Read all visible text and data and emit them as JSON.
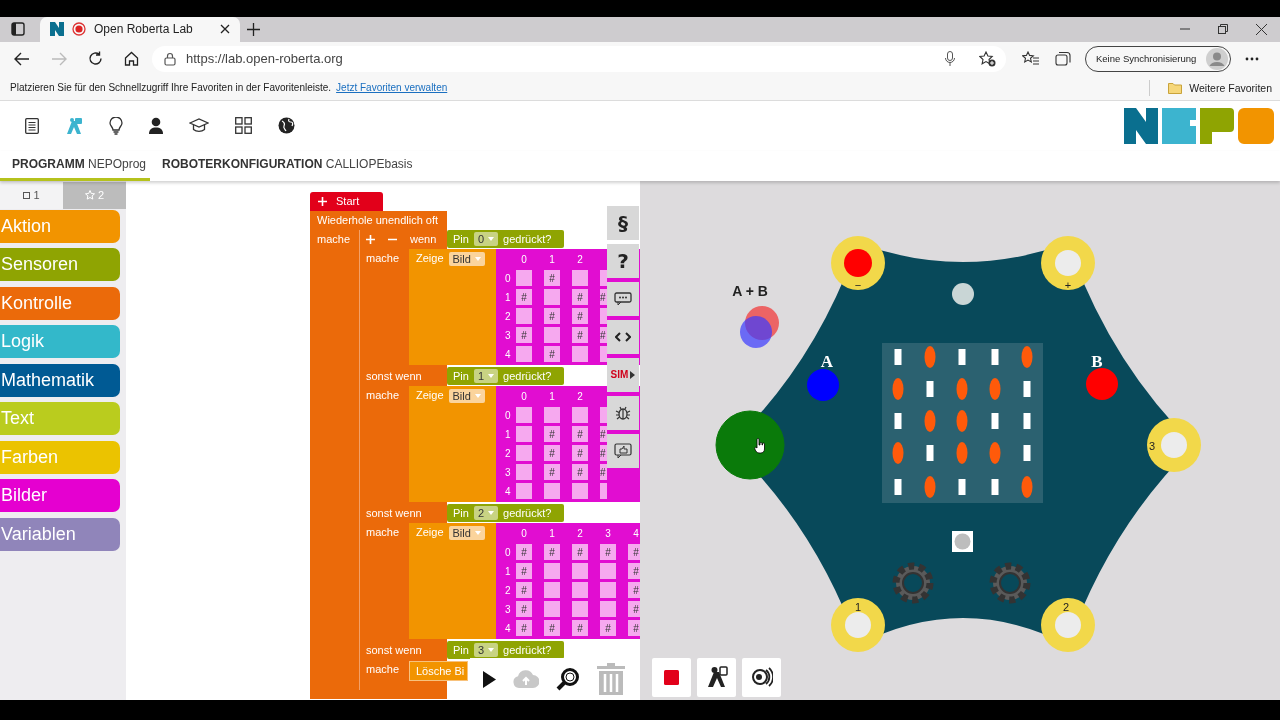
{
  "browser": {
    "tab_title": "Open Roberta Lab",
    "url": "https://lab.open-roberta.org",
    "profile": "Keine Synchronisierung",
    "favorites_hint": "Platzieren Sie für den Schnellzugriff Ihre Favoriten in der Favoritenleiste.",
    "favorites_link": "Jetzt Favoriten verwalten",
    "other_favorites": "Weitere Favoriten"
  },
  "app_tabs": [
    {
      "label": "**PROGRAMM** NEPOprog",
      "selected": true
    },
    {
      "label": "**ROBOTERKONFIGURATION** CALLIOPEbasis",
      "selected": false
    }
  ],
  "toolbox": {
    "levels": [
      {
        "label": "1",
        "selected": true
      },
      {
        "label": "2",
        "selected": false
      }
    ],
    "categories": [
      {
        "label": "Aktion",
        "color": "#f29400"
      },
      {
        "label": "Sensoren",
        "color": "#8fa402"
      },
      {
        "label": "Kontrolle",
        "color": "#eb6a0a"
      },
      {
        "label": "Logik",
        "color": "#33b8ca"
      },
      {
        "label": "Mathematik",
        "color": "#005a94"
      },
      {
        "label": "Text",
        "color": "#bacc1e"
      },
      {
        "label": "Farben",
        "color": "#ebc300"
      },
      {
        "label": "Bilder",
        "color": "#e500d0"
      },
      {
        "label": "Variablen",
        "color": "#9085ba"
      }
    ]
  },
  "program": {
    "start": "Start",
    "loop": {
      "label": "Wiederhole unendlich oft",
      "do_label": "mache",
      "branches": [
        {
          "label": "wenn",
          "mutator": true,
          "sensor": "Pin",
          "pin": "0",
          "condition": "gedrückt?",
          "do_label": "mache",
          "statement": {
            "kind": "image",
            "verb": "Zeige",
            "field": "Bild",
            "pixel_mark": "#",
            "columns": [
              "0",
              "1",
              "2"
            ],
            "rows": [
              {
                "index": "0",
                "cells": [
                  false,
                  true,
                  false,
                  false
                ]
              },
              {
                "index": "1",
                "cells": [
                  true,
                  false,
                  true,
                  true
                ]
              },
              {
                "index": "2",
                "cells": [
                  false,
                  true,
                  true,
                  false
                ]
              },
              {
                "index": "3",
                "cells": [
                  true,
                  false,
                  true,
                  true
                ]
              },
              {
                "index": "4",
                "cells": [
                  false,
                  true,
                  false,
                  false
                ]
              }
            ]
          }
        },
        {
          "label": "sonst wenn",
          "mutator": false,
          "sensor": "Pin",
          "pin": "1",
          "condition": "gedrückt?",
          "do_label": "mache",
          "statement": {
            "kind": "image",
            "verb": "Zeige",
            "field": "Bild",
            "pixel_mark": "#",
            "columns": [
              "0",
              "1",
              "2"
            ],
            "rows": [
              {
                "index": "0",
                "cells": [
                  false,
                  false,
                  false,
                  false
                ]
              },
              {
                "index": "1",
                "cells": [
                  false,
                  true,
                  true,
                  true
                ]
              },
              {
                "index": "2",
                "cells": [
                  false,
                  true,
                  true,
                  true
                ]
              },
              {
                "index": "3",
                "cells": [
                  false,
                  true,
                  true,
                  true
                ]
              },
              {
                "index": "4",
                "cells": [
                  false,
                  false,
                  false,
                  false
                ]
              }
            ]
          }
        },
        {
          "label": "sonst wenn",
          "mutator": false,
          "sensor": "Pin",
          "pin": "2",
          "condition": "gedrückt?",
          "do_label": "mache",
          "statement": {
            "kind": "image",
            "verb": "Zeige",
            "field": "Bild",
            "pixel_mark": "#",
            "columns": [
              "0",
              "1",
              "2",
              "3",
              "4"
            ],
            "rows": [
              {
                "index": "0",
                "cells": [
                  true,
                  true,
                  true,
                  true,
                  true
                ]
              },
              {
                "index": "1",
                "cells": [
                  true,
                  false,
                  false,
                  false,
                  true
                ]
              },
              {
                "index": "2",
                "cells": [
                  true,
                  false,
                  false,
                  false,
                  true
                ]
              },
              {
                "index": "3",
                "cells": [
                  true,
                  false,
                  false,
                  false,
                  true
                ]
              },
              {
                "index": "4",
                "cells": [
                  true,
                  true,
                  true,
                  true,
                  true
                ]
              }
            ]
          }
        },
        {
          "label": "sonst wenn",
          "mutator": false,
          "sensor": "Pin",
          "pin": "3",
          "condition": "gedrückt?",
          "do_label": "mache",
          "statement": {
            "kind": "clear",
            "verb": "Lösche Bi"
          }
        }
      ]
    }
  },
  "workspace_tools": [
    {
      "kind": "text",
      "label": "§"
    },
    {
      "kind": "text",
      "label": "?"
    },
    {
      "kind": "comment"
    },
    {
      "kind": "code"
    },
    {
      "kind": "sim",
      "label": "SIM"
    },
    {
      "kind": "debug"
    },
    {
      "kind": "feedback"
    }
  ],
  "simulator": {
    "ab_label": "A + B",
    "buttons": [
      {
        "label": "A",
        "color": "#0000ff"
      },
      {
        "label": "B",
        "color": "#ff0000"
      }
    ],
    "pins": [
      {
        "label": "−",
        "kind": "led",
        "pressed": false
      },
      {
        "label": "+",
        "kind": "ring",
        "pressed": false
      },
      {
        "label": "3",
        "kind": "ring",
        "pressed": false
      },
      {
        "label": "2",
        "kind": "ring",
        "pressed": false
      },
      {
        "label": "1",
        "kind": "ring",
        "pressed": false
      },
      {
        "kind": "ring",
        "pressed": true
      }
    ],
    "leds": [
      [
        false,
        true,
        false,
        false,
        true
      ],
      [
        true,
        false,
        true,
        true,
        false
      ],
      [
        false,
        true,
        true,
        false,
        false
      ],
      [
        true,
        false,
        true,
        true,
        false
      ],
      [
        false,
        true,
        false,
        false,
        true
      ]
    ]
  }
}
